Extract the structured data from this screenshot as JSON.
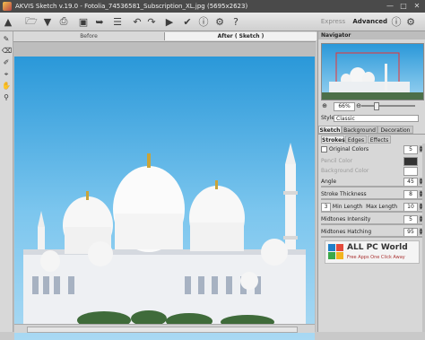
{
  "titlebar": {
    "title": "AKVIS Sketch v.19.0 - Fotolia_74536581_Subscription_XL.jpg (5695x2623)"
  },
  "toolbar": {
    "mode_express": "Express",
    "mode_advanced": "Advanced"
  },
  "canvas": {
    "tab_before": "Before",
    "tab_after": "After ( Sketch )"
  },
  "navigator": {
    "header": "Navigator",
    "zoom": "66%"
  },
  "settings": {
    "style_label": "Style:",
    "style_value": "Classic",
    "tabs": [
      "Sketch",
      "Background",
      "Decoration"
    ],
    "subtabs": [
      "Strokes",
      "Edges",
      "Effects"
    ],
    "params": {
      "original_colors": "Original Colors",
      "original_colors_value": "5",
      "pencil_color": "Pencil Color",
      "background_color": "Background Color",
      "angle": "Angle",
      "angle_value": "45",
      "stroke_thickness": "Stroke Thickness",
      "stroke_thickness_value": "8",
      "min_length_value": "3",
      "min_length": "Min Length",
      "max_length": "Max Length",
      "max_length_value": "10",
      "midtones_intensity": "Midtones Intensity",
      "midtones_intensity_value": "5",
      "midtones_hatching": "Midtones Hatching",
      "midtones_hatching_value": "95"
    }
  },
  "watermark": {
    "title": "ALL PC World",
    "tagline": "Free Apps One Click Away"
  },
  "colors": {
    "sky": "#2a98d9",
    "titlebar": "#4a4a4a",
    "accent_blue": "#1f7fc8"
  }
}
